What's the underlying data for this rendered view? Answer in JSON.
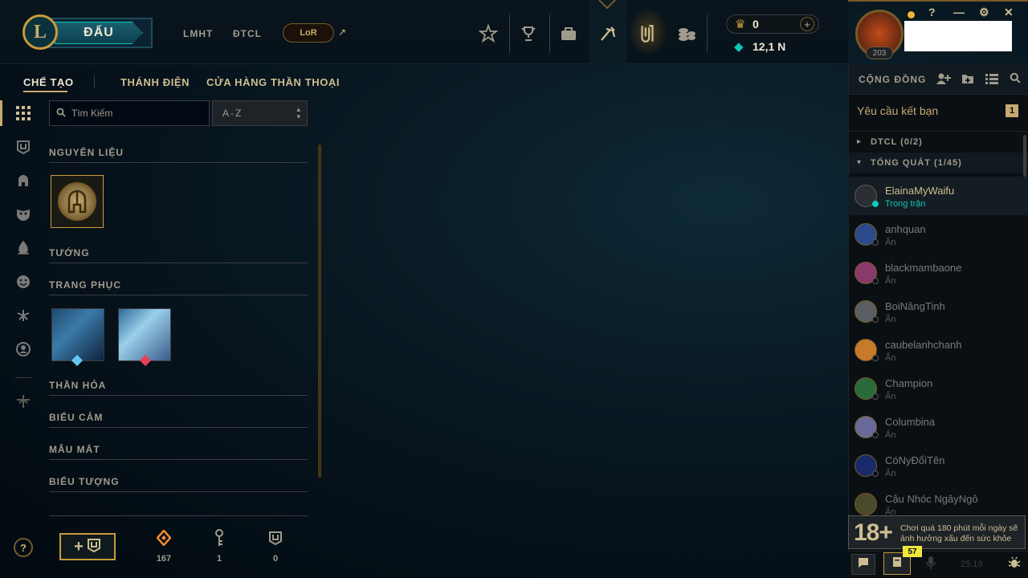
{
  "header": {
    "logo": "L",
    "play_label": "ĐẤU",
    "links": [
      "LMHT",
      "ĐTCL"
    ],
    "lor_label": "LoR",
    "lor_arrow": "↗",
    "top_icons": [
      "star-icon",
      "trophy-icon",
      "bag-icon",
      "tft-icon",
      "loot-icon",
      "store-icon"
    ],
    "currency": {
      "rp": "0",
      "be": "12,1 N",
      "add": "+"
    },
    "profile": {
      "level": "203"
    },
    "window_controls": {
      "help": "?",
      "minimize": "—",
      "settings": "⚙",
      "close": "✕"
    }
  },
  "subnav": {
    "tabs": [
      "CHẾ TẠO",
      "THÁNH ĐIỆN",
      "CỬA HÀNG THẦN THOẠI"
    ]
  },
  "search": {
    "placeholder": "Tìm Kiếm",
    "sort": "A-Z"
  },
  "categories": {
    "materials": "NGUYÊN LIỆU",
    "champions": "TƯỚNG",
    "skins": "TRANG PHỤC",
    "wards": "THẦN HỎA",
    "emotes": "BIỂU CẢM",
    "eyes": "MẪU MẮT",
    "icons": "BIỂU TƯỢNG"
  },
  "bottom": {
    "help": "?",
    "craft_label": "+",
    "counts": {
      "essence": "167",
      "keys": "1",
      "chests": "0"
    }
  },
  "social": {
    "header": "CỘNG ĐỒNG",
    "friend_requests": {
      "label": "Yêu cầu kết bạn",
      "count": "1"
    },
    "groups": [
      {
        "label": "DTCL (0/2)",
        "arrow": "▸"
      },
      {
        "label": "TỔNG QUÁT (1/45)",
        "arrow": "▾"
      }
    ],
    "friends": [
      {
        "name": "ElainaMyWaifu",
        "status": "Trong trận"
      },
      {
        "name": "anhquan",
        "status": "Ẩn"
      },
      {
        "name": "blackmambaone",
        "status": "Ẩn"
      },
      {
        "name": "BoiNăngTinh",
        "status": "Ẩn"
      },
      {
        "name": "caubelanhchanh",
        "status": "Ẩn"
      },
      {
        "name": "Champion",
        "status": "Ẩn"
      },
      {
        "name": "Columbina",
        "status": "Ẩn"
      },
      {
        "name": "CóNyĐổiTên",
        "status": "Ẩn"
      },
      {
        "name": "Cậu Nhóc NgâyNgô",
        "status": "Ẩn"
      }
    ],
    "age_warning": {
      "rating": "18+",
      "text": "Chơi quá 180 phút mỗi ngày sẽ ảnh hưởng xấu đến sức khỏe"
    },
    "bottom_bar": {
      "badge": "57",
      "version": "25.19"
    }
  },
  "colors": {
    "gold": "#c8aa6e",
    "teal": "#0ac8b9",
    "bg": "#010a13"
  }
}
